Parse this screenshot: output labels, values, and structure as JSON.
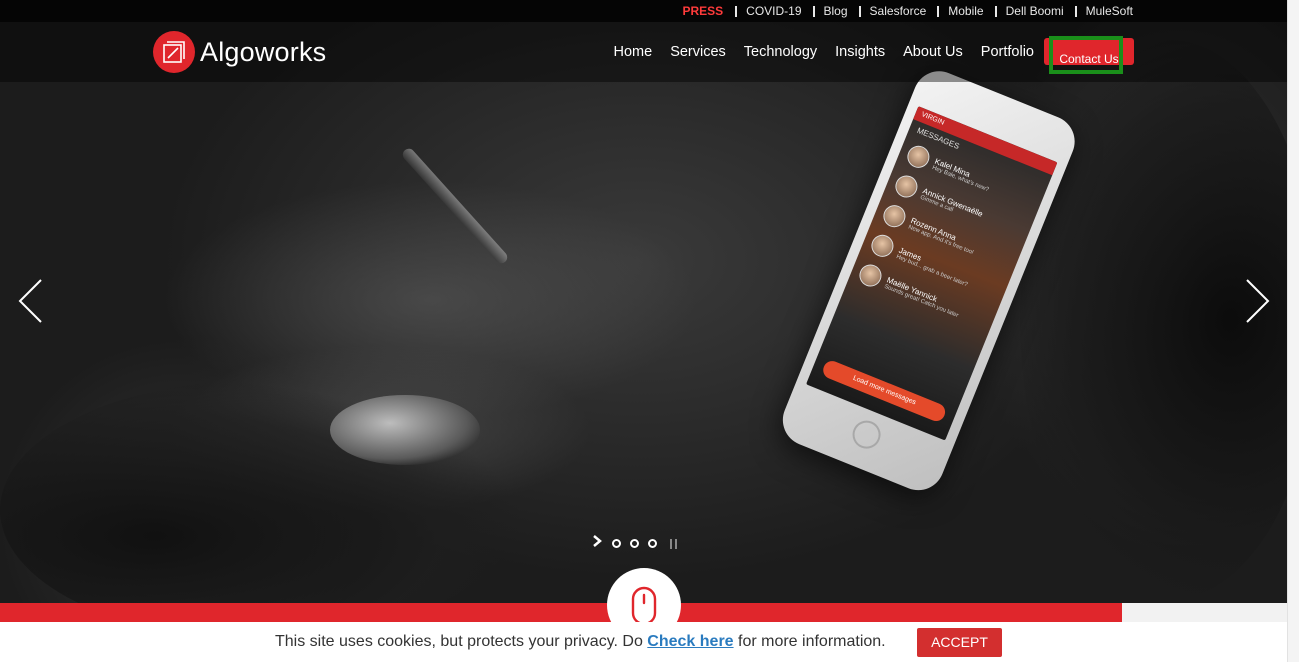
{
  "topbar": {
    "press_label": "PRESS",
    "links": [
      "COVID-19",
      "Blog",
      "Salesforce",
      "Mobile",
      "Dell Boomi",
      "MuleSoft"
    ]
  },
  "header": {
    "logo_text": "Algoworks",
    "nav": [
      "Home",
      "Services",
      "Technology",
      "Insights",
      "About Us",
      "Portfolio"
    ],
    "contact_label": "Contact Us"
  },
  "hero": {
    "phone_screen": {
      "status": "VIRGIN",
      "title": "MESSAGES",
      "contacts": [
        {
          "name": "Kalel Mina",
          "preview": "Hey Bale, what's new?"
        },
        {
          "name": "Annick Gwenaëlle",
          "preview": "Gimme a call"
        },
        {
          "name": "Rozenn Anna",
          "preview": "New app. And it's free too!"
        },
        {
          "name": "James",
          "preview": "Hey bud... grab a beer later?"
        },
        {
          "name": "Maëlle Yannick",
          "preview": "Sounds great! Catch you later"
        }
      ],
      "load_more": "Load more messages"
    },
    "slider": {
      "total_slides": 3,
      "active_index": 0
    }
  },
  "cookie": {
    "text_before": "This site uses cookies, but protects your privacy. Do ",
    "link_text": "Check here",
    "text_after": " for more information.",
    "accept_label": "ACCEPT"
  },
  "colors": {
    "brand_red": "#e0262c",
    "focus_green": "#1a8f1a",
    "link_blue": "#2a7bbf"
  }
}
